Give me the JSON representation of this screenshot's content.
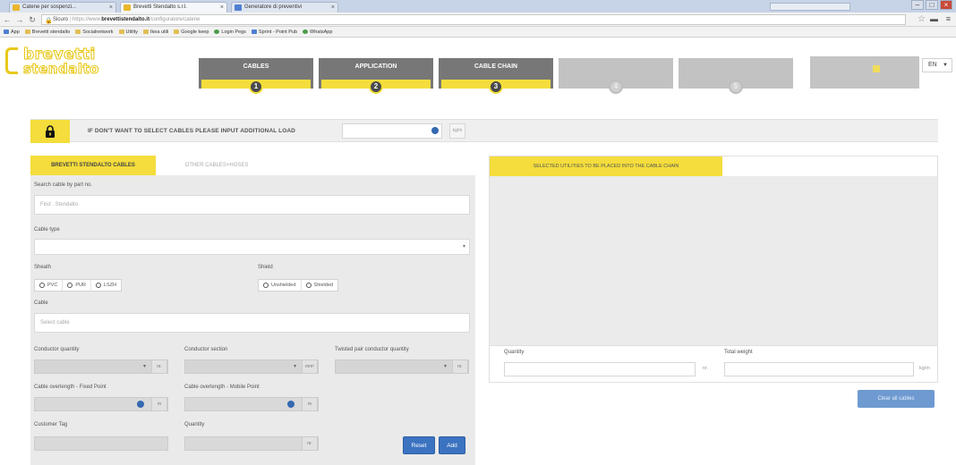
{
  "browser": {
    "tabs": [
      {
        "label": "Catene per sospenzi...",
        "active": false
      },
      {
        "label": "Brevetti Stendalto s.r.l.",
        "active": true
      },
      {
        "label": "Generatore di preventivi",
        "active": false
      }
    ],
    "url_scheme": "Sicuro",
    "url_prefix": "https://www.",
    "url_domain": "brevettistendalto.it",
    "url_path": "/configuratore/catene",
    "profile": "",
    "bookmarks": [
      "App",
      "Brevetti stendalto",
      "Socialnetwork",
      "Utility",
      "Ikea utili",
      "Google keep",
      "Login Pegs",
      "Sprint - Point Pub",
      "WhatsApp"
    ]
  },
  "header": {
    "logo_line1": "brevetti",
    "logo_line2": "stendalto",
    "steps": [
      {
        "label": "CABLES",
        "number": "1",
        "active": true
      },
      {
        "label": "APPLICATION",
        "number": "2",
        "active": true
      },
      {
        "label": "CABLE CHAIN",
        "number": "3",
        "active": true
      },
      {
        "label": "",
        "number": "4",
        "active": false
      },
      {
        "label": "",
        "number": "5",
        "active": false
      }
    ],
    "language": "EN"
  },
  "additional_load": {
    "label": "IF DON'T WANT TO SELECT CABLES PLEASE INPUT ADDITIONAL LOAD",
    "unit": "kg/m",
    "value": ""
  },
  "left_panel": {
    "tab_active": "BREVETTI STENDALTO CABLES",
    "tab_other": "OTHER CABLES+HOSES",
    "search_label": "Search cable by part no.",
    "search_placeholder": "Find . Stendalto",
    "cable_type_label": "Cable type",
    "cable_type_value": "",
    "sheath_label": "Sheath",
    "sheath_options": [
      "PVC",
      "PUR",
      "LSZH"
    ],
    "shield_label": "Shield",
    "shield_options": [
      "Unshielded",
      "Shielded"
    ],
    "cable_label": "Cable",
    "cable_placeholder": "Select cable",
    "conductor_quantity_label": "Conductor quantity",
    "conductor_quantity_unit": "nr.",
    "conductor_section_label": "Conductor section",
    "conductor_section_unit": "mm²",
    "twisted_label": "Twisted pair conductor quantity",
    "twisted_unit": "nr.",
    "overlength_fixed_label": "Cable overlength - Fixed Point",
    "overlength_fixed_unit": "m",
    "overlength_mobile_label": "Cable overlength - Mobile Point",
    "overlength_mobile_unit": "m",
    "customer_tag_label": "Customer Tag",
    "quantity_label": "Quantity",
    "quantity_unit": "nr.",
    "reset_label": "Reset",
    "add_label": "Add"
  },
  "right_panel": {
    "tab_label": "SELECTED UTILITIES TO BE PLACED INTO THE CABLE CHAIN",
    "quantity_label": "Quantity",
    "quantity_unit": "nr.",
    "total_weight_label": "Total weight",
    "total_weight_unit": "kg/m",
    "clear_label": "Clear all cables"
  },
  "colors": {
    "accent_yellow": "#f4dd3c",
    "step_gray": "#777777",
    "button_blue": "#3b73c0"
  }
}
